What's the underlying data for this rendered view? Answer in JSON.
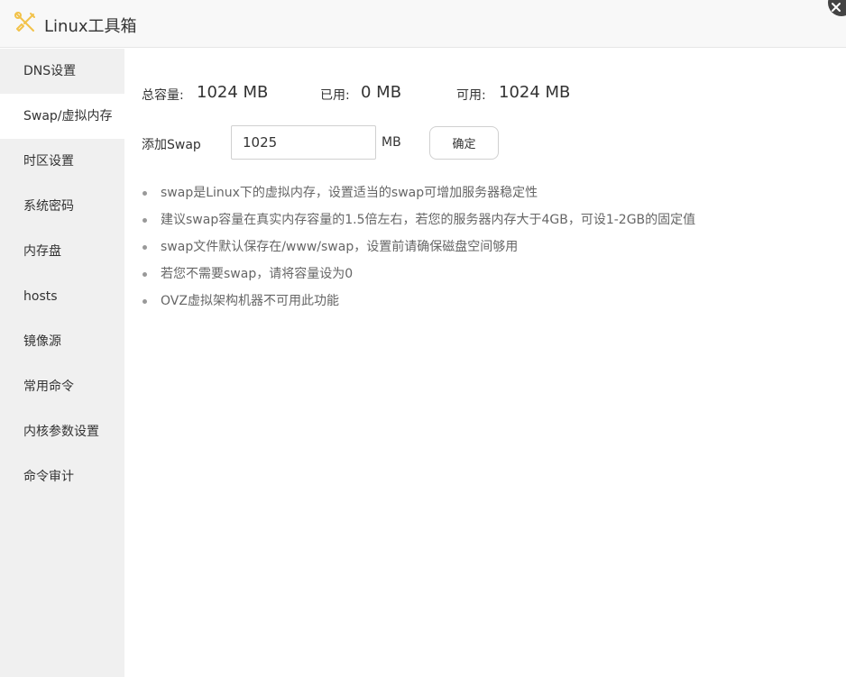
{
  "window": {
    "title": "Linux工具箱"
  },
  "sidebar": {
    "items": [
      {
        "label": "DNS设置",
        "active": false
      },
      {
        "label": "Swap/虚拟内存",
        "active": true
      },
      {
        "label": "时区设置",
        "active": false
      },
      {
        "label": "系统密码",
        "active": false
      },
      {
        "label": "内存盘",
        "active": false
      },
      {
        "label": "hosts",
        "active": false
      },
      {
        "label": "镜像源",
        "active": false
      },
      {
        "label": "常用命令",
        "active": false
      },
      {
        "label": "内核参数设置",
        "active": false
      },
      {
        "label": "命令审计",
        "active": false
      }
    ]
  },
  "stats": {
    "total_label": "总容量:",
    "total_value": "1024 MB",
    "used_label": "已用:",
    "used_value": "0 MB",
    "available_label": "可用:",
    "available_value": "1024 MB"
  },
  "add_swap": {
    "label": "添加Swap",
    "value": "1025",
    "unit": "MB",
    "confirm_label": "确定"
  },
  "tips": [
    "swap是Linux下的虚拟内存，设置适当的swap可增加服务器稳定性",
    "建议swap容量在真实内存容量的1.5倍左右，若您的服务器内存大于4GB，可设1-2GB的固定值",
    "swap文件默认保存在/www/swap，设置前请确保磁盘空间够用",
    "若您不需要swap，请将容量设为0",
    "OVZ虚拟架构机器不可用此功能"
  ],
  "icons": {
    "title": "tools-icon",
    "close": "close-icon"
  },
  "colors": {
    "sidebar_bg": "#f0f0f0",
    "active_item_bg": "#ffffff",
    "title_icon": "#f2c24a",
    "close_bg": "#444444"
  }
}
